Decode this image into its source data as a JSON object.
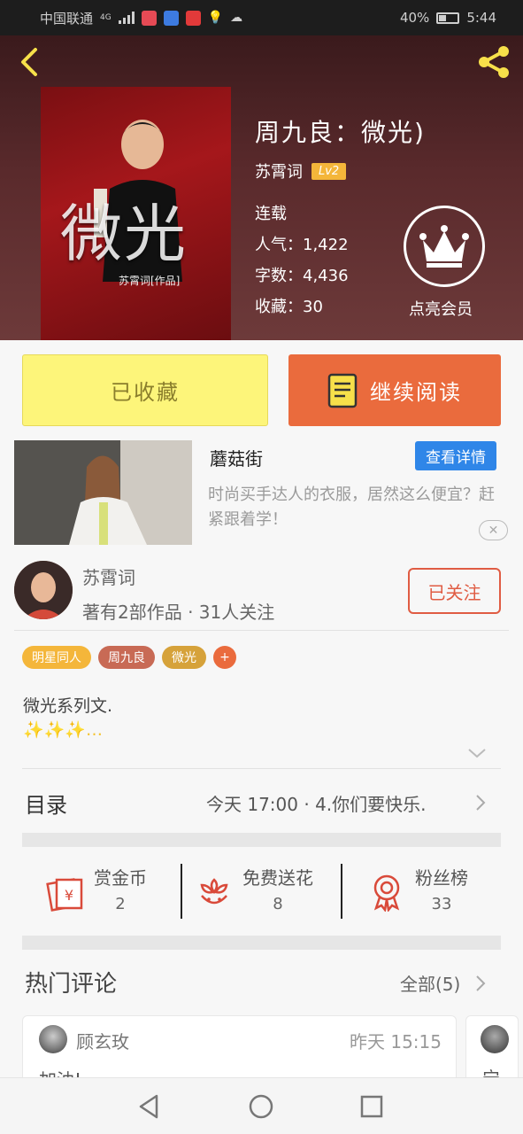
{
  "status_bar": {
    "carrier": "中国联通",
    "network": "4G",
    "battery": "40%",
    "time": "5:44",
    "icons": [
      "signal-icon",
      "calendar-app-icon",
      "music-app-icon",
      "video-app-icon",
      "lightbulb-icon",
      "cloud-icon",
      "battery-icon"
    ]
  },
  "header": {
    "back_icon": "chevron-left-icon",
    "share_icon": "share-icon",
    "cover_big_text": "微光",
    "cover_small_text": "苏霄词[作品]",
    "book_title": "周九良：微光)",
    "author": "苏霄词",
    "level": "Lv2",
    "status": "连载",
    "popularity": "人气：1,422",
    "word_count": "字数：4,436",
    "favorites": "收藏：30",
    "vip_icon": "crown-icon",
    "vip_label": "点亮会员"
  },
  "actions": {
    "collected_label": "已收藏",
    "continue_label": "继续阅读",
    "continue_icon": "book-icon"
  },
  "ad": {
    "title": "蘑菇街",
    "detail_button": "查看详情",
    "description": "时尚买手达人的衣服，居然这么便宜？赶紧跟着学！",
    "close_label": "✕"
  },
  "author_block": {
    "name": "苏霄词",
    "stats": "著有2部作品 · 31人关注",
    "follow_label": "已关注"
  },
  "tags": [
    {
      "label": "明星同人",
      "color": "#f4b63a"
    },
    {
      "label": "周九良",
      "color": "#c86a55"
    },
    {
      "label": "微光",
      "color": "#d6a23a"
    }
  ],
  "tag_add": "+",
  "description": {
    "line1": "微光系列文.",
    "line2": "✨✨✨…"
  },
  "toc": {
    "label": "目录",
    "latest": "今天 17:00 · 4.你们要快乐."
  },
  "stats": [
    {
      "label": "赏金币",
      "value": "2",
      "icon": "red-envelope-icon"
    },
    {
      "label": "免费送花",
      "value": "8",
      "icon": "flower-icon"
    },
    {
      "label": "粉丝榜",
      "value": "33",
      "icon": "medal-icon"
    }
  ],
  "comments": {
    "label": "热门评论",
    "all_label": "全部(5)",
    "items": [
      {
        "user": "顾玄玫",
        "time": "昨天 15:15",
        "text": "加油!"
      },
      {
        "user": "",
        "time": "",
        "text": "宁"
      }
    ]
  },
  "nav": {
    "back": "nav-back-icon",
    "home": "nav-home-icon",
    "recents": "nav-recents-icon"
  },
  "colors": {
    "accent_orange": "#ea6b3d",
    "collected_yellow": "#fdf57a",
    "gold": "#f4b63a",
    "blue": "#2f86e8"
  }
}
